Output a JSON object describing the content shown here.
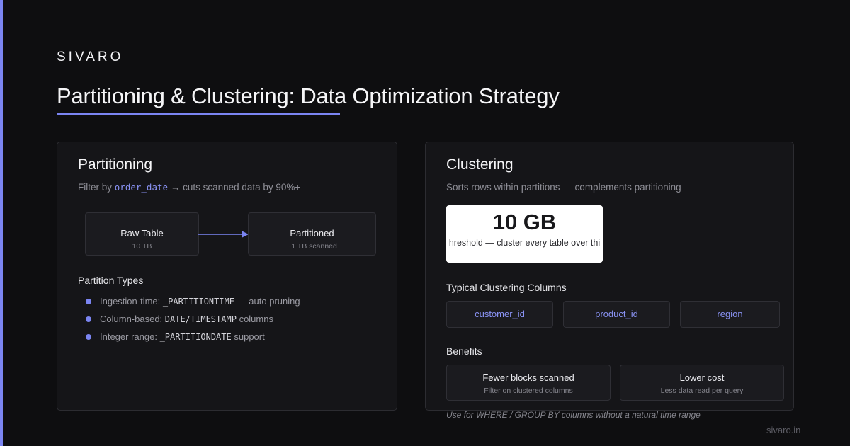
{
  "brand": "SIVARO",
  "title": "Partitioning & Clustering: Data Optimization Strategy",
  "colors": {
    "accent": "#7b85f2",
    "background": "#0e0e10",
    "card": "#151518"
  },
  "partitioning": {
    "title": "Partitioning",
    "subtitle_prefix": "Filter by",
    "subtitle_code": "order_date",
    "subtitle_suffix": "→ cuts scanned data by 90%+",
    "flow": {
      "from": {
        "label": "Raw Table",
        "sub": "10 TB"
      },
      "to": {
        "label": "Partitioned",
        "sub": "~1 TB scanned"
      }
    },
    "types_heading": "Partition Types",
    "types": [
      {
        "prefix": "Ingestion-time:",
        "code": "_PARTITIONTIME",
        "suffix": "— auto pruning"
      },
      {
        "prefix": "Column-based:",
        "code": "DATE/TIMESTAMP",
        "suffix": "columns"
      },
      {
        "prefix": "Integer range:",
        "code": "_PARTITIONDATE",
        "suffix": "support"
      }
    ]
  },
  "clustering": {
    "title": "Clustering",
    "subtitle": "Sorts rows within partitions — complements partitioning",
    "stat_value": "10 GB",
    "stat_caption": "hreshold — cluster every table over thi",
    "columns_heading": "Typical Clustering Columns",
    "columns": [
      "customer_id",
      "product_id",
      "region"
    ],
    "benefits_heading": "Benefits",
    "benefits": [
      {
        "title": "Fewer blocks scanned",
        "sub": "Filter on clustered columns"
      },
      {
        "title": "Lower cost",
        "sub": "Less data read per query"
      }
    ],
    "note": "Use for WHERE / GROUP BY columns without a natural time range"
  },
  "footer_url": "sivaro.in"
}
